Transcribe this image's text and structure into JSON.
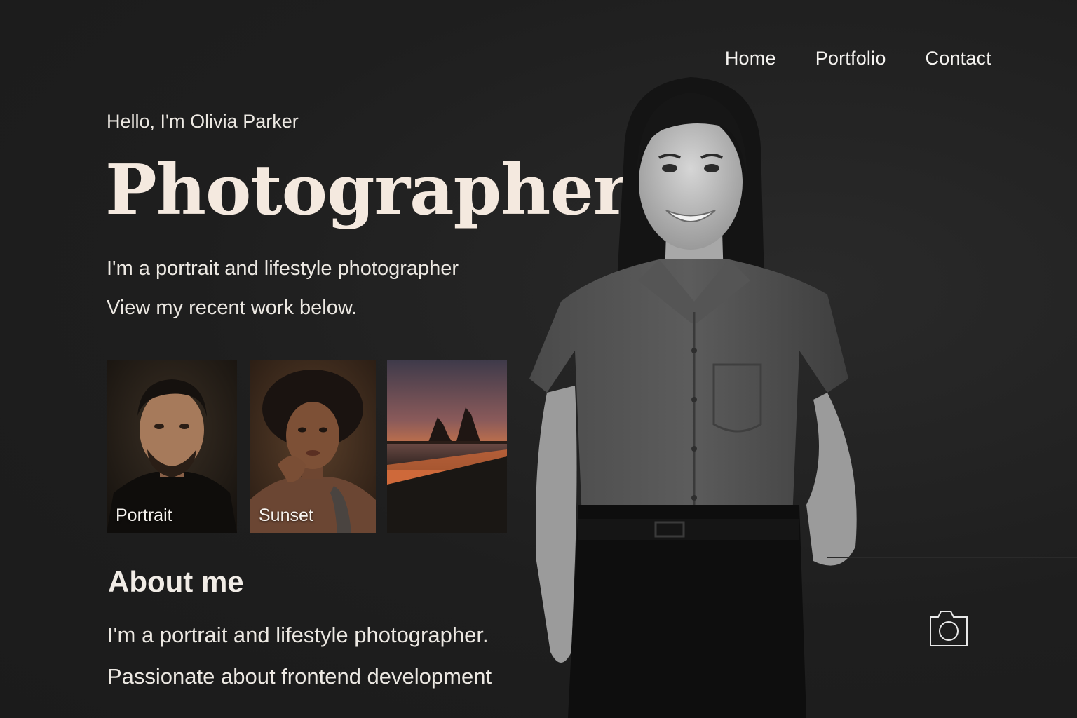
{
  "nav": {
    "items": [
      {
        "label": "Home"
      },
      {
        "label": "Portfolio"
      },
      {
        "label": "Contact"
      }
    ]
  },
  "hero": {
    "greeting": "Hello, I'm Olivia Parker",
    "title": "Photographer",
    "subtitle_line1": "I'm a portrait and lifestyle photographer",
    "subtitle_line2": "View my recent work below."
  },
  "gallery": {
    "items": [
      {
        "caption": "Portrait",
        "icon": "portrait-man-photo"
      },
      {
        "caption": "Sunset",
        "icon": "portrait-woman-photo"
      },
      {
        "caption": "",
        "icon": "beach-sunset-photo"
      }
    ]
  },
  "about": {
    "heading": "About me",
    "line1": "I'm a portrait and lifestyle photographer.",
    "line2": "Passionate about frontend development"
  },
  "icons": {
    "camera": "camera-icon"
  },
  "colors": {
    "background": "#1f1f1f",
    "title": "#f4e9df",
    "text": "#ece8e2",
    "sunset_orange": "#d77a45"
  }
}
